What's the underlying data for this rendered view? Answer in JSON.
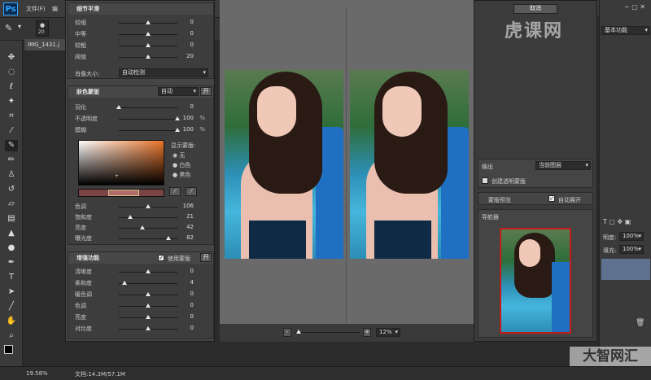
{
  "menubar": {
    "logo": "Ps",
    "items": [
      "文件(F)",
      "编"
    ]
  },
  "options": {
    "brush_size": "20"
  },
  "doc_tab": {
    "label": "IMG_1431.j"
  },
  "detail_smoothing": {
    "title": "细节平滑",
    "rows": [
      {
        "label": "较细",
        "value": "0",
        "pos": 0.5
      },
      {
        "label": "中等",
        "value": "0",
        "pos": 0.5
      },
      {
        "label": "较粗",
        "value": "0",
        "pos": 0.5
      },
      {
        "label": "阈值",
        "value": "20",
        "pos": 0.5
      }
    ],
    "portrait_size_label": "肖像大小:",
    "portrait_size_value": "自动检测"
  },
  "skin_mask": {
    "title": "肤色蒙版",
    "mode": "自动",
    "toggle": "开",
    "rows": [
      {
        "label": "羽化",
        "value": "0",
        "unit": "",
        "pos": 0.0
      },
      {
        "label": "不透明度",
        "value": "100",
        "unit": "%",
        "pos": 1.0
      },
      {
        "label": "模糊",
        "value": "100",
        "unit": "%",
        "pos": 1.0
      }
    ],
    "show_mask_label": "显示蒙版:",
    "mask_options": [
      "无",
      "白色",
      "黑色"
    ],
    "color_rows": [
      {
        "label": "色调",
        "value": "106",
        "pos": 0.5
      },
      {
        "label": "饱和度",
        "value": "21",
        "pos": 0.2
      },
      {
        "label": "亮度",
        "value": "42",
        "pos": 0.4
      },
      {
        "label": "曝光度",
        "value": "82",
        "pos": 0.85
      }
    ]
  },
  "enhance": {
    "title": "增强功能",
    "use_mask": "使用蒙版",
    "toggle": "开",
    "rows": [
      {
        "label": "清晰度",
        "value": "0",
        "pos": 0.5
      },
      {
        "label": "柔和度",
        "value": "4",
        "pos": 0.1
      },
      {
        "label": "暖色调",
        "value": "0",
        "pos": 0.5
      },
      {
        "label": "色调",
        "value": "0",
        "pos": 0.5
      },
      {
        "label": "亮度",
        "value": "0",
        "pos": 0.5
      },
      {
        "label": "对比度",
        "value": "0",
        "pos": 0.5
      }
    ]
  },
  "zoom": {
    "value": "12%",
    "minus": "-",
    "plus": "+"
  },
  "right_panel": {
    "cancel": "取消",
    "output_label": "输出",
    "output_value": "当前图层",
    "create_mask": "创建透明蒙版",
    "mask_preview": "蒙版预览",
    "auto_expand": "自动展开",
    "navigator": "导航器"
  },
  "sidebar": {
    "preset": "基本功能",
    "opacity_label": "明度:",
    "opacity_value": "100%",
    "fill_label": "填充:",
    "fill_value": "100%"
  },
  "status": {
    "zoom": "19.58%",
    "doc": "文档:14.3M/57.1M"
  },
  "watermarks": {
    "top": "虎课网",
    "bottom": "大智网汇"
  }
}
